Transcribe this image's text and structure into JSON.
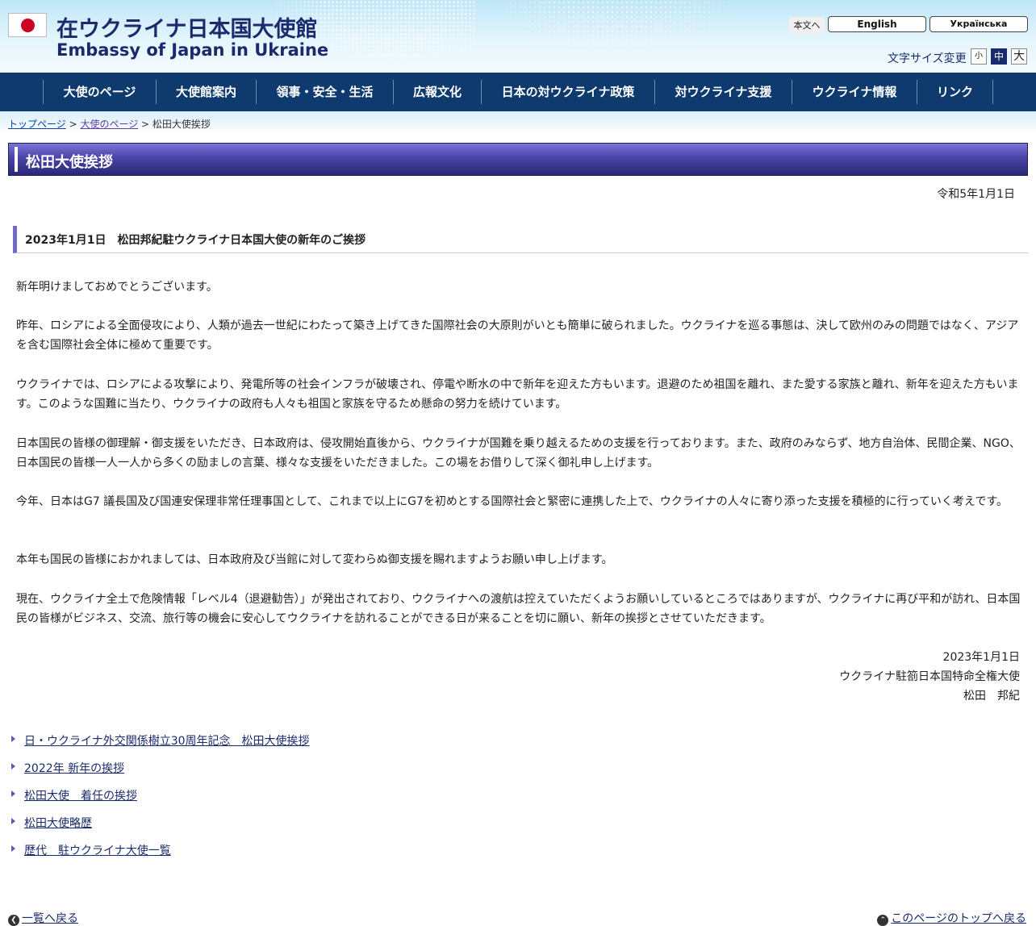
{
  "header": {
    "title_ja": "在ウクライナ日本国大使館",
    "title_en": "Embassy of Japan in Ukraine",
    "skip_link": "本文へ",
    "lang_en": "English",
    "lang_uk": "Українська",
    "font_size_label": "文字サイズ変更",
    "font_small": "小",
    "font_mid": "中",
    "font_large": "大"
  },
  "nav": {
    "items": [
      {
        "label": "大使のページ"
      },
      {
        "label": "大使館案内"
      },
      {
        "label": "領事・安全・生活"
      },
      {
        "label": "広報文化"
      },
      {
        "label": "日本の対ウクライナ政策"
      },
      {
        "label": "対ウクライナ支援"
      },
      {
        "label": "ウクライナ情報"
      },
      {
        "label": "リンク"
      }
    ]
  },
  "breadcrumb": {
    "top": "トップページ",
    "sep1": " > ",
    "ambassador": "大使のページ",
    "sep2": " > ",
    "current": "松田大使挨拶"
  },
  "page": {
    "title": "松田大使挨拶",
    "date": "令和5年1月1日",
    "section_heading": "2023年1月1日　松田邦紀駐ウクライナ日本国大使の新年のご挨拶",
    "paragraphs": [
      "新年明けましておめでとうございます。",
      "昨年、ロシアによる全面侵攻により、人類が過去一世紀にわたって築き上げてきた国際社会の大原則がいとも簡単に破られました。ウクライナを巡る事態は、決して欧州のみの問題ではなく、アジアを含む国際社会全体に極めて重要です。",
      "ウクライナでは、ロシアによる攻撃により、発電所等の社会インフラが破壊され、停電や断水の中で新年を迎えた方もいます。退避のため祖国を離れ、また愛する家族と離れ、新年を迎えた方もいます。このような国難に当たり、ウクライナの政府も人々も祖国と家族を守るため懸命の努力を続けています。",
      "日本国民の皆様の御理解・御支援をいただき、日本政府は、侵攻開始直後から、ウクライナが国難を乗り越えるための支援を行っております。また、政府のみならず、地方自治体、民間企業、NGO、日本国民の皆様一人一人から多くの励ましの言葉、様々な支援をいただきました。この場をお借りして深く御礼申し上げます。",
      "今年、日本はG7 議長国及び国連安保理非常任理事国として、これまで以上にG7を初めとする国際社会と緊密に連携した上で、ウクライナの人々に寄り添った支援を積極的に行っていく考えです。",
      "本年も国民の皆様におかれましては、日本政府及び当館に対して変わらぬ御支援を賜れますようお願い申し上げます。",
      "現在、ウクライナ全土で危険情報「レベル4（退避勧告）」が発出されており、ウクライナへの渡航は控えていただくようお願いしているところではありますが、ウクライナに再び平和が訪れ、日本国民の皆様がビジネス、交流、旅行等の機会に安心してウクライナを訪れることができる日が来ることを切に願い、新年の挨拶とさせていただきます。"
    ],
    "signature": {
      "date": "2023年1月1日",
      "title": "ウクライナ駐箚日本国特命全権大使",
      "name": "松田　邦紀"
    }
  },
  "related_links": [
    {
      "label": "日・ウクライナ外交関係樹立30周年記念　松田大使挨拶"
    },
    {
      "label": "2022年 新年の挨拶"
    },
    {
      "label": "松田大使　着任の挨拶"
    },
    {
      "label": "松田大使略歴"
    },
    {
      "label": "歴代　駐ウクライナ大使一覧"
    }
  ],
  "footer_nav": {
    "back_to_list": "一覧へ戻る",
    "to_top": "このページのトップへ戻る"
  },
  "colors": {
    "nav_bg": "#0e3a6e",
    "title_text": "#1a2a6c",
    "title_bar_gradient_top": "#7a73d9",
    "title_bar_gradient_bottom": "#2a2775",
    "flag_red": "#cc0022"
  }
}
